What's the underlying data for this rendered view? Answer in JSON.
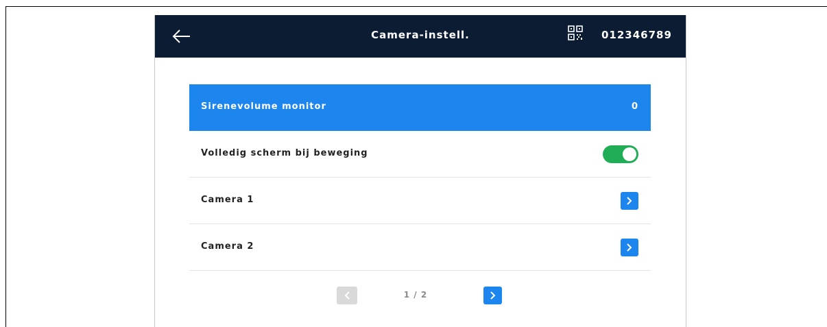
{
  "header": {
    "title": "Camera-instell.",
    "device_id": "012346789",
    "back_icon": "arrow-left-icon",
    "qr_icon": "qr-code-icon"
  },
  "settings": {
    "items": [
      {
        "label": "Sirenevolume monitor",
        "value": "0",
        "type": "value",
        "selected": true
      },
      {
        "label": "Volledig scherm bij beweging",
        "type": "toggle",
        "enabled": true
      },
      {
        "label": "Camera 1",
        "type": "link",
        "icon": "chevron-right-icon"
      },
      {
        "label": "Camera 2",
        "type": "link",
        "icon": "chevron-right-icon"
      }
    ]
  },
  "pagination": {
    "text": "1 / 2",
    "current_page": 1,
    "total_pages": 2,
    "prev_enabled": false,
    "next_enabled": true
  },
  "colors": {
    "header_bg": "#0c1d33",
    "accent": "#1d85ee",
    "toggle_on": "#21ad56",
    "disabled": "#d9d9d9"
  }
}
